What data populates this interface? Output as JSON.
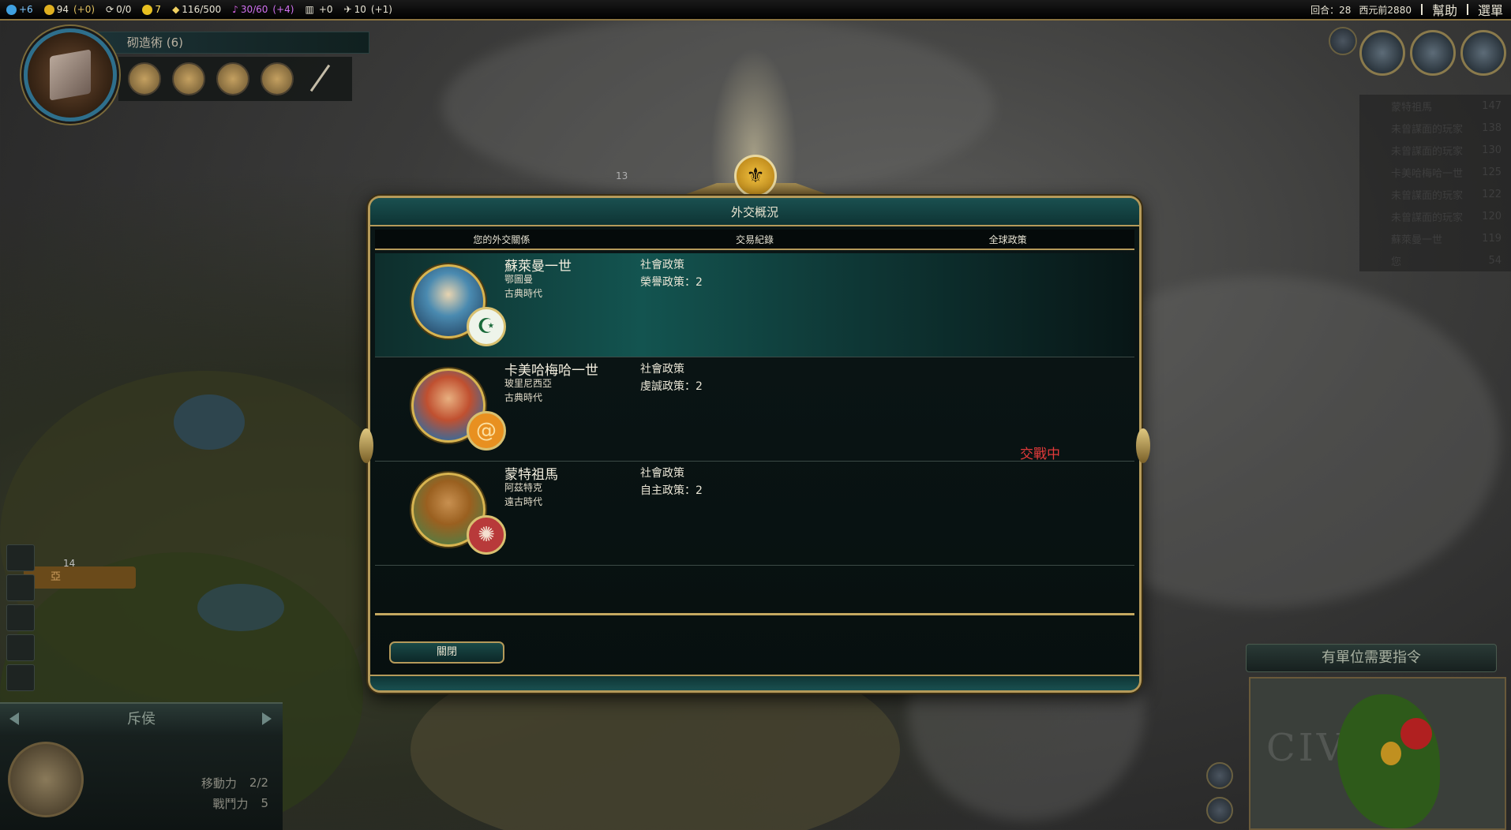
{
  "topbar": {
    "science": "+6",
    "gold": "94",
    "gold_mod": "(+0)",
    "trade": "0/0",
    "happiness": "7",
    "golden_age": "116/500",
    "culture": "30/60",
    "culture_mod": "(+4)",
    "tourism": "+0",
    "faith": "10",
    "faith_mod": "(+1)",
    "turn": "回合：28",
    "year": "西元前2880",
    "help": "幫助",
    "menu": "選單"
  },
  "tech": {
    "name": "砌造術 (6)"
  },
  "minimap_panel": {
    "title": "有單位需要指令"
  },
  "unit": {
    "name": "斥侯",
    "moves_label": "移動力",
    "moves_value": "2/2",
    "strength_label": "戰鬥力",
    "strength_value": "5"
  },
  "map_labels": {
    "city_size_top": "13",
    "city_size_left": "14",
    "city_name_left": "亞"
  },
  "dialog": {
    "title": "外交概況",
    "tabs": [
      "您的外交關係",
      "交易紀錄",
      "全球政策"
    ],
    "close_label": "關閉",
    "leaders": [
      {
        "name": "蘇萊曼一世",
        "civ": "鄂圖曼",
        "era": "古典時代",
        "policy_title": "社會政策",
        "policy_value": "榮譽政策：2",
        "status": ""
      },
      {
        "name": "卡美哈梅哈一世",
        "civ": "玻里尼西亞",
        "era": "古典時代",
        "policy_title": "社會政策",
        "policy_value": "虔誠政策：2",
        "status": "交戰中"
      },
      {
        "name": "蒙特祖馬",
        "civ": "阿茲特克",
        "era": "遠古時代",
        "policy_title": "社會政策",
        "policy_value": "自主政策：2",
        "status": ""
      }
    ]
  },
  "scores": [
    {
      "name": "蒙特祖馬",
      "value": "147"
    },
    {
      "name": "未曾謀面的玩家",
      "value": "138"
    },
    {
      "name": "未曾謀面的玩家",
      "value": "130"
    },
    {
      "name": "卡美哈梅哈一世",
      "value": "125"
    },
    {
      "name": "未曾謀面的玩家",
      "value": "122"
    },
    {
      "name": "未曾謀面的玩家",
      "value": "120"
    },
    {
      "name": "蘇萊曼一世",
      "value": "119"
    },
    {
      "name": "您",
      "value": "54"
    }
  ],
  "colors": {
    "accent_gold": "#b59a5a",
    "war_red": "#e23a3a",
    "panel_teal": "#135450"
  }
}
